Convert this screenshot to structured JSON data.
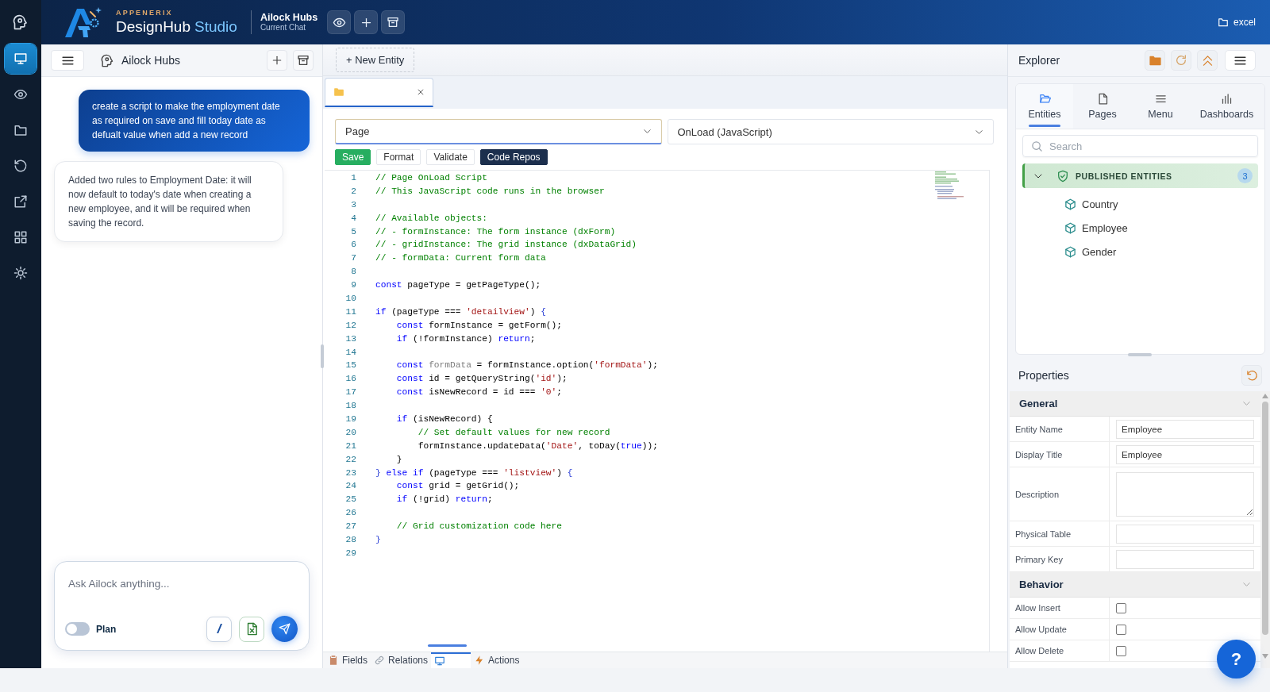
{
  "rail": {
    "items": [
      {
        "selected": true
      },
      {
        "selected": false
      },
      {
        "selected": false
      },
      {
        "selected": false
      },
      {
        "selected": false
      },
      {
        "selected": false
      },
      {
        "selected": false
      }
    ]
  },
  "top_bar": {
    "brand_tagline": "APPENERIX",
    "brand_name": "DesignHub",
    "brand_accent": "Studio",
    "hub_title": "Ailock Hubs",
    "hub_subtitle": "Current Chat",
    "workspace_label": "excel"
  },
  "chat": {
    "title": "Ailock Hubs",
    "messages": [
      {
        "kind": "user",
        "text": "create a script to make the employment date as required on save and fill today date as defualt value when add a new record"
      },
      {
        "kind": "assistant",
        "text": "Added two rules to Employment Date: it will now default to today's date when creating a new employee, and it will be required when saving the record."
      }
    ],
    "composer": {
      "placeholder": "Ask Ailock anything...",
      "plan_toggle": {
        "label": "Plan",
        "on": false
      },
      "command_button": "/"
    }
  },
  "editor": {
    "new_entity_button": "+ New Entity",
    "tabs": [
      {
        "selected": true
      }
    ],
    "page_select": {
      "value": "Page",
      "focused": true
    },
    "event_select": {
      "value": "OnLoad (JavaScript)",
      "focused": false
    },
    "actions": [
      {
        "label": "Save",
        "kind": "primary"
      },
      {
        "label": "Format",
        "kind": "plain"
      },
      {
        "label": "Validate",
        "kind": "plain"
      },
      {
        "label": "Code Repos",
        "kind": "dark"
      }
    ],
    "code_lines": [
      {
        "number": "1",
        "tokens": [
          {
            "kind": "comment",
            "text": "// Page OnLoad Script"
          }
        ]
      },
      {
        "number": "2",
        "tokens": [
          {
            "kind": "comment",
            "text": "// This JavaScript code runs in the browser"
          }
        ]
      },
      {
        "number": "3"
      },
      {
        "number": "4",
        "tokens": [
          {
            "kind": "comment",
            "text": "// Available objects:"
          }
        ]
      },
      {
        "number": "5",
        "tokens": [
          {
            "kind": "comment",
            "text": "// - formInstance: The form instance (dxForm)"
          }
        ]
      },
      {
        "number": "6",
        "tokens": [
          {
            "kind": "comment",
            "text": "// - gridInstance: The grid instance (dxDataGrid)"
          }
        ]
      },
      {
        "number": "7",
        "tokens": [
          {
            "kind": "comment",
            "text": "// - formData: Current form data"
          }
        ]
      },
      {
        "number": "8"
      },
      {
        "number": "9",
        "tokens": [
          {
            "kind": "keyword",
            "text": "const"
          },
          {
            "kind": "text",
            "text": " pageType = getPageType();"
          }
        ]
      },
      {
        "number": "10"
      },
      {
        "number": "11",
        "tokens": [
          {
            "kind": "keyword",
            "text": "if"
          },
          {
            "kind": "text",
            "text": " (pageType === "
          },
          {
            "kind": "string",
            "text": "'detailview'"
          },
          {
            "kind": "text",
            "text": ")"
          },
          {
            "kind": "brace",
            "text": " {"
          }
        ]
      },
      {
        "number": "12",
        "tokens": [
          {
            "kind": "keyword",
            "text": "    const"
          },
          {
            "kind": "text",
            "text": " formInstance = getForm();"
          }
        ]
      },
      {
        "number": "13",
        "tokens": [
          {
            "kind": "keyword",
            "text": "    if"
          },
          {
            "kind": "text",
            "text": " (!formInstance)"
          },
          {
            "kind": "keyword",
            "text": " return"
          },
          {
            "kind": "text",
            "text": ";"
          }
        ]
      },
      {
        "number": "14"
      },
      {
        "number": "15",
        "tokens": [
          {
            "kind": "keyword",
            "text": "    const"
          },
          {
            "kind": "muted",
            "text": " formData"
          },
          {
            "kind": "text",
            "text": " = formInstance.option("
          },
          {
            "kind": "string",
            "text": "'formData'"
          },
          {
            "kind": "text",
            "text": ");"
          }
        ]
      },
      {
        "number": "16",
        "tokens": [
          {
            "kind": "keyword",
            "text": "    const"
          },
          {
            "kind": "text",
            "text": " id = getQueryString("
          },
          {
            "kind": "string",
            "text": "'id'"
          },
          {
            "kind": "text",
            "text": ");"
          }
        ]
      },
      {
        "number": "17",
        "tokens": [
          {
            "kind": "keyword",
            "text": "    const"
          },
          {
            "kind": "text",
            "text": " isNewRecord = id === "
          },
          {
            "kind": "string",
            "text": "'0'"
          },
          {
            "kind": "text",
            "text": ";"
          }
        ]
      },
      {
        "number": "18"
      },
      {
        "number": "19",
        "tokens": [
          {
            "kind": "keyword",
            "text": "    if"
          },
          {
            "kind": "text",
            "text": " (isNewRecord) {"
          }
        ]
      },
      {
        "number": "20",
        "tokens": [
          {
            "kind": "comment",
            "text": "        // Set default values for new record"
          }
        ]
      },
      {
        "number": "21",
        "tokens": [
          {
            "kind": "text",
            "text": "        formInstance.updateData("
          },
          {
            "kind": "string",
            "text": "'Date'"
          },
          {
            "kind": "text",
            "text": ", toDay("
          },
          {
            "kind": "keyword",
            "text": "true"
          },
          {
            "kind": "text",
            "text": "));"
          }
        ]
      },
      {
        "number": "22",
        "tokens": [
          {
            "kind": "text",
            "text": "    }"
          }
        ]
      },
      {
        "number": "23",
        "tokens": [
          {
            "kind": "brace",
            "text": "}"
          },
          {
            "kind": "keyword",
            "text": " else if"
          },
          {
            "kind": "text",
            "text": " (pageType === "
          },
          {
            "kind": "string",
            "text": "'listview'"
          },
          {
            "kind": "text",
            "text": ")"
          },
          {
            "kind": "brace",
            "text": " {"
          }
        ]
      },
      {
        "number": "24",
        "tokens": [
          {
            "kind": "keyword",
            "text": "    const"
          },
          {
            "kind": "text",
            "text": " grid = getGrid();"
          }
        ]
      },
      {
        "number": "25",
        "tokens": [
          {
            "kind": "keyword",
            "text": "    if"
          },
          {
            "kind": "text",
            "text": " (!grid)"
          },
          {
            "kind": "keyword",
            "text": " return"
          },
          {
            "kind": "text",
            "text": ";"
          }
        ]
      },
      {
        "number": "26"
      },
      {
        "number": "27",
        "tokens": [
          {
            "kind": "comment",
            "text": "    // Grid customization code here"
          }
        ]
      },
      {
        "number": "28",
        "tokens": [
          {
            "kind": "brace",
            "text": "}"
          }
        ]
      },
      {
        "number": "29"
      }
    ],
    "bottom_tabs": [
      {
        "label": "Fields",
        "selected": false
      },
      {
        "label": "Relations",
        "selected": false
      },
      {
        "selected": true
      },
      {
        "label": "Actions",
        "selected": false
      }
    ]
  },
  "explorer": {
    "title": "Explorer",
    "tabs": [
      {
        "label": "Entities",
        "selected": true
      },
      {
        "label": "Pages",
        "selected": false
      },
      {
        "label": "Menu",
        "selected": false
      },
      {
        "label": "Dashboards",
        "selected": false
      }
    ],
    "search": {
      "placeholder": "Search"
    },
    "groups": [
      {
        "label": "PUBLISHED ENTITIES",
        "count": "3",
        "expanded": true,
        "children": [
          {
            "label": "Country"
          },
          {
            "label": "Employee"
          },
          {
            "label": "Gender"
          }
        ]
      }
    ]
  },
  "properties": {
    "title": "Properties",
    "sections": [
      {
        "title": "General",
        "expanded": true,
        "rows": [
          {
            "label": "Entity Name",
            "kind": "text",
            "value": "Employee"
          },
          {
            "label": "Display Title",
            "kind": "text",
            "value": "Employee"
          },
          {
            "label": "Description",
            "kind": "textarea"
          },
          {
            "label": "Physical Table",
            "kind": "text"
          },
          {
            "label": "Primary Key",
            "kind": "text"
          }
        ]
      },
      {
        "title": "Behavior",
        "expanded": true,
        "rows": [
          {
            "label": "Allow Insert",
            "kind": "checkbox",
            "checked": false
          },
          {
            "label": "Allow Update",
            "kind": "checkbox",
            "checked": false
          },
          {
            "label": "Allow Delete",
            "kind": "checkbox",
            "checked": false
          }
        ]
      }
    ]
  },
  "help_button": "?"
}
